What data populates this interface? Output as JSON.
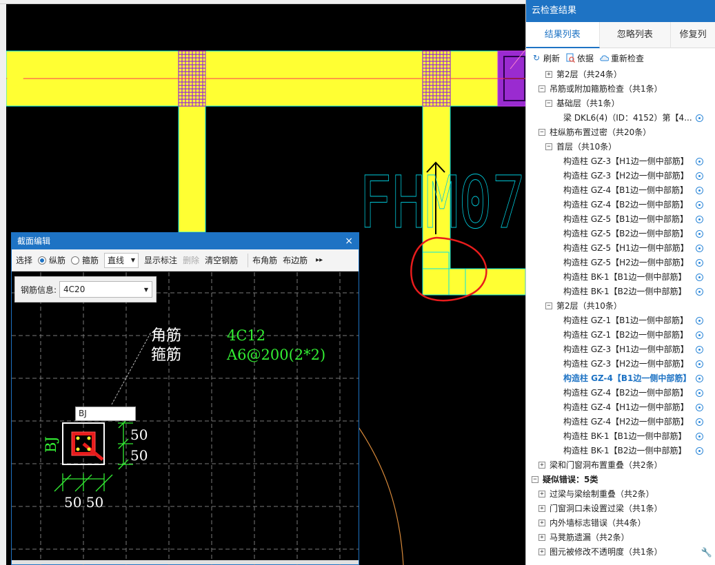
{
  "canvas": {
    "door_label": "FHM07",
    "colors": {
      "beam": "#ffff33",
      "grid_purple": "#9a2bd0",
      "axis_red": "#ff3355",
      "highlight_red": "#e81c1c",
      "edge_cyan": "#00e6e6"
    }
  },
  "panel": {
    "title": "云检查结果",
    "tabs": [
      {
        "label": "结果列表",
        "active": true
      },
      {
        "label": "忽略列表",
        "active": false
      },
      {
        "label": "修复列",
        "active": false
      }
    ],
    "toolbar": {
      "refresh": "刷新",
      "basis": "依据",
      "recheck": "重新检查"
    },
    "tree": [
      {
        "level": 1,
        "exp": "+",
        "label": "第2层（共24条）",
        "loc": false
      },
      {
        "level": 0,
        "exp": "−",
        "label": "吊筋或附加箍筋检查（共1条）",
        "loc": false
      },
      {
        "level": 1,
        "exp": "−",
        "label": "基础层（共1条）",
        "loc": false
      },
      {
        "level": 2,
        "exp": "",
        "label": "梁 DKL6(4)（ID：4152）第【4...",
        "loc": true
      },
      {
        "level": 0,
        "exp": "−",
        "label": "柱纵筋布置过密（共20条）",
        "loc": false
      },
      {
        "level": 1,
        "exp": "−",
        "label": "首层（共10条）",
        "loc": false
      },
      {
        "level": 2,
        "exp": "",
        "label": "构造柱 GZ-3【H1边一侧中部筋】",
        "loc": true
      },
      {
        "level": 2,
        "exp": "",
        "label": "构造柱 GZ-3【H2边一侧中部筋】",
        "loc": true
      },
      {
        "level": 2,
        "exp": "",
        "label": "构造柱 GZ-4【B1边一侧中部筋】",
        "loc": true
      },
      {
        "level": 2,
        "exp": "",
        "label": "构造柱 GZ-4【B2边一侧中部筋】",
        "loc": true
      },
      {
        "level": 2,
        "exp": "",
        "label": "构造柱 GZ-5【B1边一侧中部筋】",
        "loc": true
      },
      {
        "level": 2,
        "exp": "",
        "label": "构造柱 GZ-5【B2边一侧中部筋】",
        "loc": true
      },
      {
        "level": 2,
        "exp": "",
        "label": "构造柱 GZ-5【H1边一侧中部筋】",
        "loc": true
      },
      {
        "level": 2,
        "exp": "",
        "label": "构造柱 GZ-5【H2边一侧中部筋】",
        "loc": true
      },
      {
        "level": 2,
        "exp": "",
        "label": "构造柱 BK-1【B1边一侧中部筋】",
        "loc": true
      },
      {
        "level": 2,
        "exp": "",
        "label": "构造柱 BK-1【B2边一侧中部筋】",
        "loc": true
      },
      {
        "level": 1,
        "exp": "−",
        "label": "第2层（共10条）",
        "loc": false
      },
      {
        "level": 2,
        "exp": "",
        "label": "构造柱 GZ-1【B1边一侧中部筋】",
        "loc": true
      },
      {
        "level": 2,
        "exp": "",
        "label": "构造柱 GZ-1【B2边一侧中部筋】",
        "loc": true
      },
      {
        "level": 2,
        "exp": "",
        "label": "构造柱 GZ-3【H1边一侧中部筋】",
        "loc": true
      },
      {
        "level": 2,
        "exp": "",
        "label": "构造柱 GZ-3【H2边一侧中部筋】",
        "loc": true
      },
      {
        "level": 2,
        "exp": "",
        "label": "构造柱 GZ-4【B1边一侧中部筋】",
        "loc": true,
        "selected": true
      },
      {
        "level": 2,
        "exp": "",
        "label": "构造柱 GZ-4【B2边一侧中部筋】",
        "loc": true
      },
      {
        "level": 2,
        "exp": "",
        "label": "构造柱 GZ-4【H1边一侧中部筋】",
        "loc": true
      },
      {
        "level": 2,
        "exp": "",
        "label": "构造柱 GZ-4【H2边一侧中部筋】",
        "loc": true
      },
      {
        "level": 2,
        "exp": "",
        "label": "构造柱 BK-1【B1边一侧中部筋】",
        "loc": true
      },
      {
        "level": 2,
        "exp": "",
        "label": "构造柱 BK-1【B2边一侧中部筋】",
        "loc": true
      },
      {
        "level": 0,
        "exp": "+",
        "label": "梁和门窗洞布置重叠（共2条）",
        "loc": false
      },
      {
        "level": -1,
        "exp": "−",
        "label": "疑似错误：5类",
        "loc": false,
        "bold": true
      },
      {
        "level": 0,
        "exp": "+",
        "label": "过梁与梁绘制重叠（共2条）",
        "loc": false
      },
      {
        "level": 0,
        "exp": "+",
        "label": "门窗洞口未设置过梁（共1条）",
        "loc": false
      },
      {
        "level": 0,
        "exp": "+",
        "label": "内外墙标志错误（共4条）",
        "loc": false
      },
      {
        "level": 0,
        "exp": "+",
        "label": "马凳筋遗漏（共2条）",
        "loc": false
      },
      {
        "level": 0,
        "exp": "+",
        "label": "图元被修改不透明度（共1条）",
        "loc": false
      }
    ]
  },
  "dialog": {
    "title": "截面编辑",
    "close": "×",
    "toolbar": {
      "select": "选择",
      "longitudinal": "纵筋",
      "stirrup": "箍筋",
      "line_mode": "直线",
      "show_dim": "显示标注",
      "delete": "删除",
      "clear": "清空钢筋",
      "corner": "布角筋",
      "edge": "布边筋",
      "more": "▸▸"
    },
    "rebar_info_label": "钢筋信息:",
    "rebar_info_value": "4C20",
    "annotations": {
      "corner_label": "角筋",
      "stirrup_label": "箍筋",
      "corner_value": "4C12",
      "stirrup_value": "A6@200(2*2)",
      "bj_vertical": "BJ",
      "bj_input": "BJ",
      "dim_right_top": "50",
      "dim_right_bottom": "50",
      "dim_bottom": "50 50"
    }
  }
}
